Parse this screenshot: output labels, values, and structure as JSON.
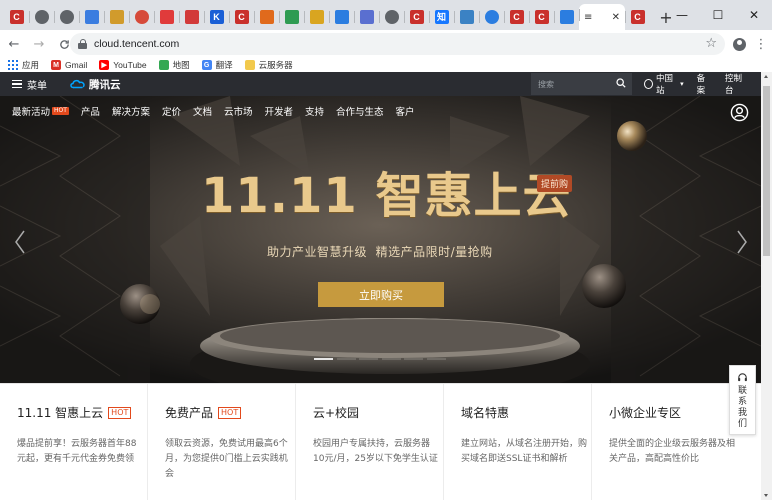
{
  "browser": {
    "tabs": [
      {
        "icon": "csdn-icon",
        "glyph": "C",
        "color": "#c9302c"
      },
      {
        "icon": "globe-icon",
        "glyph": "",
        "color": "#5f6368"
      },
      {
        "icon": "globe-icon",
        "glyph": "",
        "color": "#5f6368"
      },
      {
        "icon": "blue-square-icon",
        "glyph": "",
        "color": "#3b7de0"
      },
      {
        "icon": "yellow-fav-icon",
        "glyph": "",
        "color": "#d19b2c"
      },
      {
        "icon": "globe-red-icon",
        "glyph": "",
        "color": "#d64a3a"
      },
      {
        "icon": "red-oval-icon",
        "glyph": "",
        "color": "#e03b3b"
      },
      {
        "icon": "cube-icon",
        "glyph": "",
        "color": "#d23a3a"
      },
      {
        "icon": "k-icon",
        "glyph": "K",
        "color": "#1a5fd6"
      },
      {
        "icon": "csdn-icon",
        "glyph": "C",
        "color": "#c9302c"
      },
      {
        "icon": "matlab-icon",
        "glyph": "",
        "color": "#e06a1c"
      },
      {
        "icon": "leaf-icon",
        "glyph": "",
        "color": "#2e9b52"
      },
      {
        "icon": "bar-icon",
        "glyph": "",
        "color": "#d9a520"
      },
      {
        "icon": "flower-icon",
        "glyph": "",
        "color": "#2b7de0"
      },
      {
        "icon": "window-icon",
        "glyph": "",
        "color": "#5a6fd0"
      },
      {
        "icon": "globe-icon",
        "glyph": "",
        "color": "#5f6368"
      },
      {
        "icon": "csdn-icon",
        "glyph": "C",
        "color": "#c9302c"
      },
      {
        "icon": "zhihu-icon",
        "glyph": "知",
        "color": "#1677ff"
      },
      {
        "icon": "grid-icon",
        "glyph": "",
        "color": "#3b82c4"
      },
      {
        "icon": "globe-blue-icon",
        "glyph": "",
        "color": "#2b7de0"
      },
      {
        "icon": "csdn-icon",
        "glyph": "C",
        "color": "#c9302c"
      },
      {
        "icon": "csdn-icon",
        "glyph": "C",
        "color": "#c9302c"
      },
      {
        "icon": "cloud-icon",
        "glyph": "",
        "color": "#2b7de0"
      }
    ],
    "active_tab_glyph": "≡",
    "active_tab_close": "✕",
    "trailing_tab_glyph": "C",
    "new_tab": "+",
    "window_controls": {
      "minimize": "—",
      "maximize": "☐",
      "close": "✕"
    },
    "nav": {
      "back": "←",
      "forward": "→",
      "reload": "C"
    },
    "url": "cloud.tencent.com",
    "star": "☆",
    "menu_dots": "⋮"
  },
  "bookmarks": [
    {
      "label": "应用",
      "icon": "apps-icon"
    },
    {
      "label": "Gmail",
      "icon": "gmail-icon",
      "glyph": "M",
      "color": "#d93025"
    },
    {
      "label": "YouTube",
      "icon": "youtube-icon",
      "glyph": "▶",
      "color": "#ff0000"
    },
    {
      "label": "地图",
      "icon": "maps-icon",
      "glyph": "",
      "color": "#34a853"
    },
    {
      "label": "翻译",
      "icon": "translate-icon",
      "glyph": "G",
      "color": "#4285f4"
    },
    {
      "label": "云服务器",
      "icon": "folder-icon",
      "glyph": "",
      "color": "#f2c94c"
    }
  ],
  "header": {
    "menu_label": "菜单",
    "logo_text": "腾讯云",
    "search_placeholder": "搜索",
    "region": "中国站",
    "region_caret": "▾",
    "filing": "备案",
    "console": "控制台"
  },
  "site_nav": [
    {
      "label": "最新活动",
      "hot": "HOT"
    },
    {
      "label": "产品"
    },
    {
      "label": "解决方案"
    },
    {
      "label": "定价"
    },
    {
      "label": "文档"
    },
    {
      "label": "云市场"
    },
    {
      "label": "开发者"
    },
    {
      "label": "支持"
    },
    {
      "label": "合作与生态"
    },
    {
      "label": "客户"
    }
  ],
  "hero": {
    "title": "11.11 智惠上云",
    "badge": "提前购",
    "subtitle": "助力产业智慧升级  精选产品限时/量抢购",
    "cta": "立即购买",
    "slides_total": 6,
    "slide_active": 1
  },
  "cards": [
    {
      "title": "11.11 智惠上云",
      "hot": "HOT",
      "desc": "爆品提前享！云服务器首年88元起，更有千元代金券免费领"
    },
    {
      "title": "免费产品",
      "hot": "HOT",
      "desc": "领取云资源，免费试用最高6个月，为您提供0门槛上云实践机会"
    },
    {
      "title": "云+校园",
      "hot": "",
      "desc": "校园用户专属扶持，云服务器10元/月，25岁以下免学生认证"
    },
    {
      "title": "域名特惠",
      "hot": "",
      "desc": "建立网站，从域名注册开始，购买域名即送SSL证书和解析"
    },
    {
      "title": "小微企业专区",
      "hot": "",
      "desc": "提供全面的企业级云服务器及相关产品，高配高性价比"
    }
  ],
  "contact": {
    "label": "联系我们"
  }
}
